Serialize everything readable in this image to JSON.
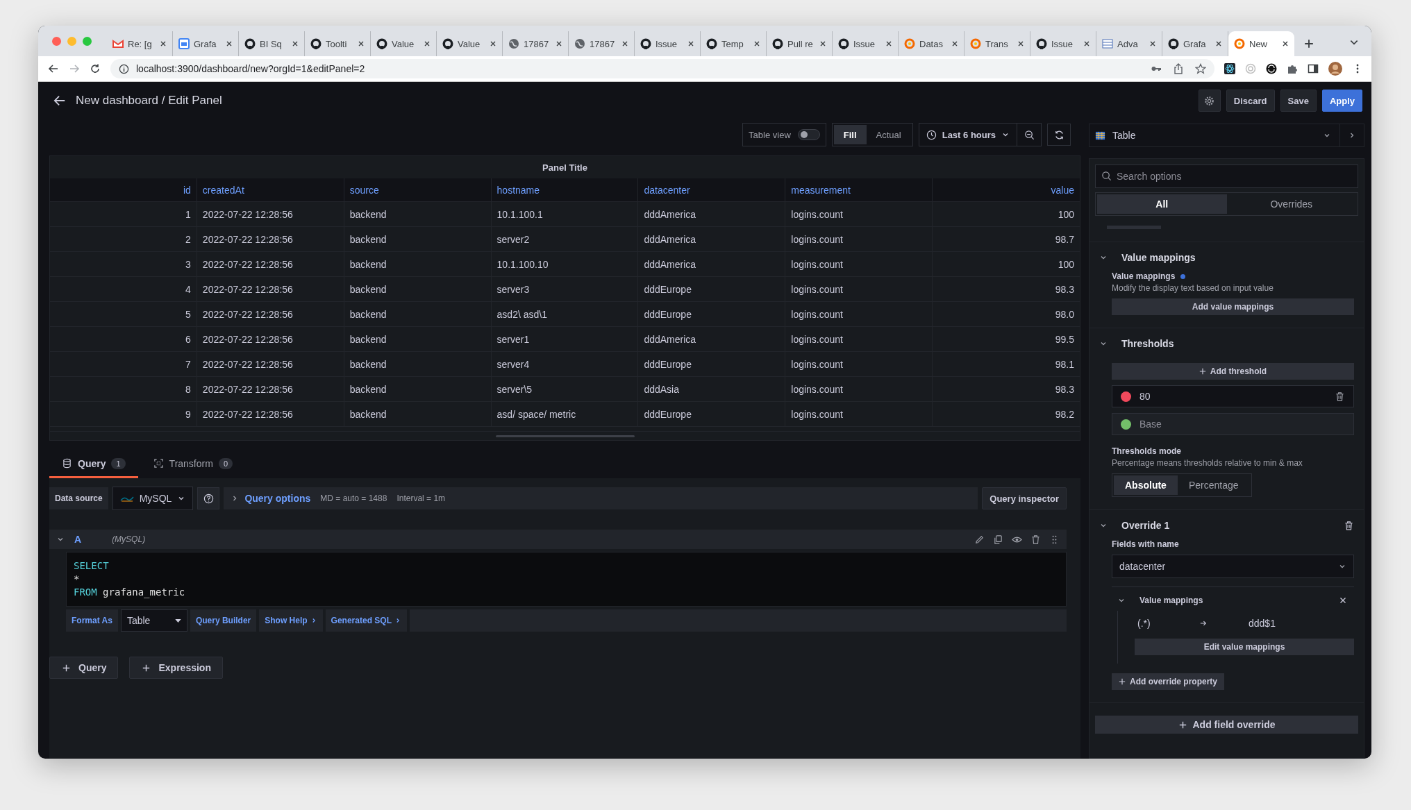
{
  "browser": {
    "tabs": [
      {
        "title": "Re: [g",
        "kind": "mail",
        "selected": false
      },
      {
        "title": "Grafa",
        "kind": "calendar",
        "selected": false
      },
      {
        "title": "BI Sq",
        "kind": "repo",
        "selected": false
      },
      {
        "title": "Toolti",
        "kind": "repo",
        "selected": false
      },
      {
        "title": "Value",
        "kind": "repo",
        "selected": false
      },
      {
        "title": "Value",
        "kind": "repo",
        "selected": false
      },
      {
        "title": "17867",
        "kind": "web",
        "selected": false
      },
      {
        "title": "17867",
        "kind": "web",
        "selected": false
      },
      {
        "title": "Issue",
        "kind": "repo",
        "selected": false
      },
      {
        "title": "Temp",
        "kind": "repo",
        "selected": false
      },
      {
        "title": "Pull re",
        "kind": "repo",
        "selected": false
      },
      {
        "title": "Issue",
        "kind": "repo",
        "selected": false
      },
      {
        "title": "Datas",
        "kind": "dashboard",
        "selected": false
      },
      {
        "title": "Trans",
        "kind": "dashboard",
        "selected": false
      },
      {
        "title": "Issue",
        "kind": "repo",
        "selected": false
      },
      {
        "title": "Adva",
        "kind": "doc",
        "selected": false
      },
      {
        "title": "Grafa",
        "kind": "repo",
        "selected": false
      },
      {
        "title": "New",
        "kind": "dashboard",
        "selected": true
      }
    ],
    "url": "localhost:3900/dashboard/new?orgId=1&editPanel=2"
  },
  "header": {
    "title": "New dashboard / Edit Panel",
    "buttons": [
      {
        "label": "Discard",
        "kind": "secondary"
      },
      {
        "label": "Save",
        "kind": "secondary"
      },
      {
        "label": "Apply",
        "kind": "primary"
      }
    ]
  },
  "toolbar": {
    "table_view": {
      "label": "Table view",
      "on": false
    },
    "modes": [
      {
        "label": "Fill",
        "selected": true
      },
      {
        "label": "Actual",
        "selected": false
      }
    ],
    "time_range": "Last 6 hours"
  },
  "panel": {
    "title": "Panel Title",
    "columns": [
      "id",
      "createdAt",
      "source",
      "hostname",
      "datacenter",
      "measurement",
      "value"
    ],
    "rows": [
      [
        "1",
        "2022-07-22 12:28:56",
        "backend",
        "10.1.100.1",
        "dddAmerica",
        "logins.count",
        "100"
      ],
      [
        "2",
        "2022-07-22 12:28:56",
        "backend",
        "server2",
        "dddAmerica",
        "logins.count",
        "98.7"
      ],
      [
        "3",
        "2022-07-22 12:28:56",
        "backend",
        "10.1.100.10",
        "dddAmerica",
        "logins.count",
        "100"
      ],
      [
        "4",
        "2022-07-22 12:28:56",
        "backend",
        "server3",
        "dddEurope",
        "logins.count",
        "98.3"
      ],
      [
        "5",
        "2022-07-22 12:28:56",
        "backend",
        "asd2\\ asd\\1",
        "dddEurope",
        "logins.count",
        "98.0"
      ],
      [
        "6",
        "2022-07-22 12:28:56",
        "backend",
        "server1",
        "dddAmerica",
        "logins.count",
        "99.5"
      ],
      [
        "7",
        "2022-07-22 12:28:56",
        "backend",
        "server4",
        "dddEurope",
        "logins.count",
        "98.1"
      ],
      [
        "8",
        "2022-07-22 12:28:56",
        "backend",
        "server\\5",
        "dddAsia",
        "logins.count",
        "98.3"
      ],
      [
        "9",
        "2022-07-22 12:28:56",
        "backend",
        "asd/ space/ metric",
        "dddEurope",
        "logins.count",
        "98.2"
      ]
    ]
  },
  "query_tabs": [
    {
      "label": "Query",
      "count": "1",
      "selected": true,
      "kind": "query"
    },
    {
      "label": "Transform",
      "count": "0",
      "selected": false,
      "kind": "transform"
    }
  ],
  "query_bar": {
    "data_source_label": "Data source",
    "data_source": "MySQL",
    "query_options": "Query options",
    "md": "MD = auto = 1488",
    "interval": "Interval = 1m",
    "inspector": "Query inspector"
  },
  "query": {
    "ref": "A",
    "source": "(MySQL)",
    "lines": [
      {
        "keyword": "SELECT"
      },
      {
        "text": "*"
      },
      {
        "keyword": "FROM",
        "text": "grafana_metric"
      }
    ],
    "format_label": "Format As",
    "format": "Table",
    "links": [
      {
        "label": "Query Builder",
        "chevron": false
      },
      {
        "label": "Show Help",
        "chevron": true
      },
      {
        "label": "Generated SQL",
        "chevron": true
      }
    ]
  },
  "add_buttons": [
    "Query",
    "Expression"
  ],
  "options": {
    "visualization": "Table",
    "search_placeholder": "Search options",
    "tabs": [
      {
        "label": "All",
        "selected": true
      },
      {
        "label": "Overrides",
        "selected": false
      }
    ],
    "value_mappings": {
      "title": "Value mappings",
      "label": "Value mappings",
      "description": "Modify the display text based on input value",
      "button": "Add value mappings"
    },
    "thresholds": {
      "title": "Thresholds",
      "add": "Add threshold",
      "steps": [
        {
          "value": "80",
          "color": "#f2495c",
          "kind": "value"
        },
        {
          "value": "Base",
          "color": "#73bf69",
          "kind": "base"
        }
      ],
      "mode_label": "Thresholds mode",
      "mode_description": "Percentage means thresholds relative to min & max",
      "modes": [
        {
          "label": "Absolute",
          "selected": true
        },
        {
          "label": "Percentage",
          "selected": false
        }
      ]
    },
    "override": {
      "title": "Override 1",
      "matcher_label": "Fields with name",
      "matcher": "datacenter",
      "property": "Value mappings",
      "mapping_from": "(.*)",
      "mapping_to": "ddd$1",
      "edit": "Edit value mappings",
      "add_property": "Add override property"
    },
    "add_override": "Add field override"
  }
}
